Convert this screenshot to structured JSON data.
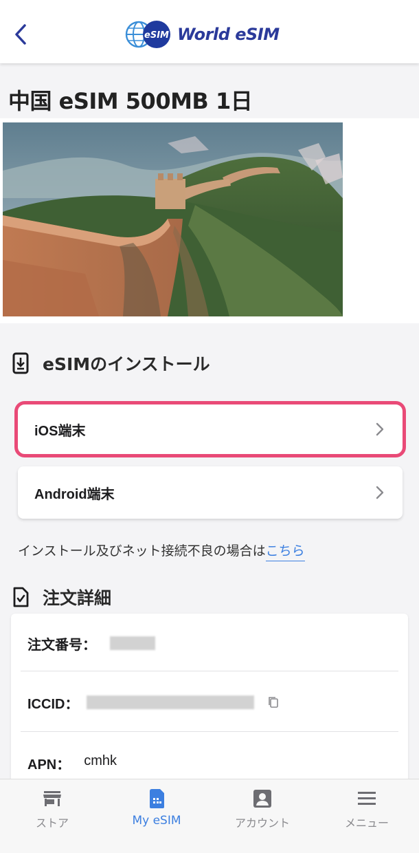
{
  "header": {
    "back_icon": "chevron-left-icon",
    "logo_badge": "eSIM",
    "logo_text": "World eSIM"
  },
  "product": {
    "title": "中国 eSIM 500MB 1日",
    "image": "great-wall-painting"
  },
  "install_section": {
    "icon": "download-device-icon",
    "title": "eSIMのインストール",
    "items": [
      {
        "label": "iOS端末",
        "highlighted": true
      },
      {
        "label": "Android端末",
        "highlighted": false
      }
    ],
    "help_text": "インストール及びネット接続不良の場合は",
    "help_link": "こちら"
  },
  "order_section": {
    "icon": "document-check-icon",
    "title": "注文詳細",
    "rows": [
      {
        "key": "注文番号：",
        "value": "",
        "redacted": true
      },
      {
        "key": "ICCID：",
        "value": "",
        "redacted": true,
        "copy_icon": "copy-icon"
      },
      {
        "key": "APN：",
        "value": "cmhk",
        "redacted": false
      }
    ]
  },
  "tabbar": {
    "tabs": [
      {
        "label": "ストア",
        "icon": "store-icon",
        "active": false
      },
      {
        "label": "My eSIM",
        "icon": "sim-card-icon",
        "active": true
      },
      {
        "label": "アカウント",
        "icon": "account-icon",
        "active": false
      },
      {
        "label": "メニュー",
        "icon": "menu-icon",
        "active": false
      }
    ]
  },
  "colors": {
    "accent": "#3c7fe0",
    "highlight": "#e94a77",
    "logo": "#2b3a9a",
    "inactive_tab": "#8a8a8e"
  }
}
